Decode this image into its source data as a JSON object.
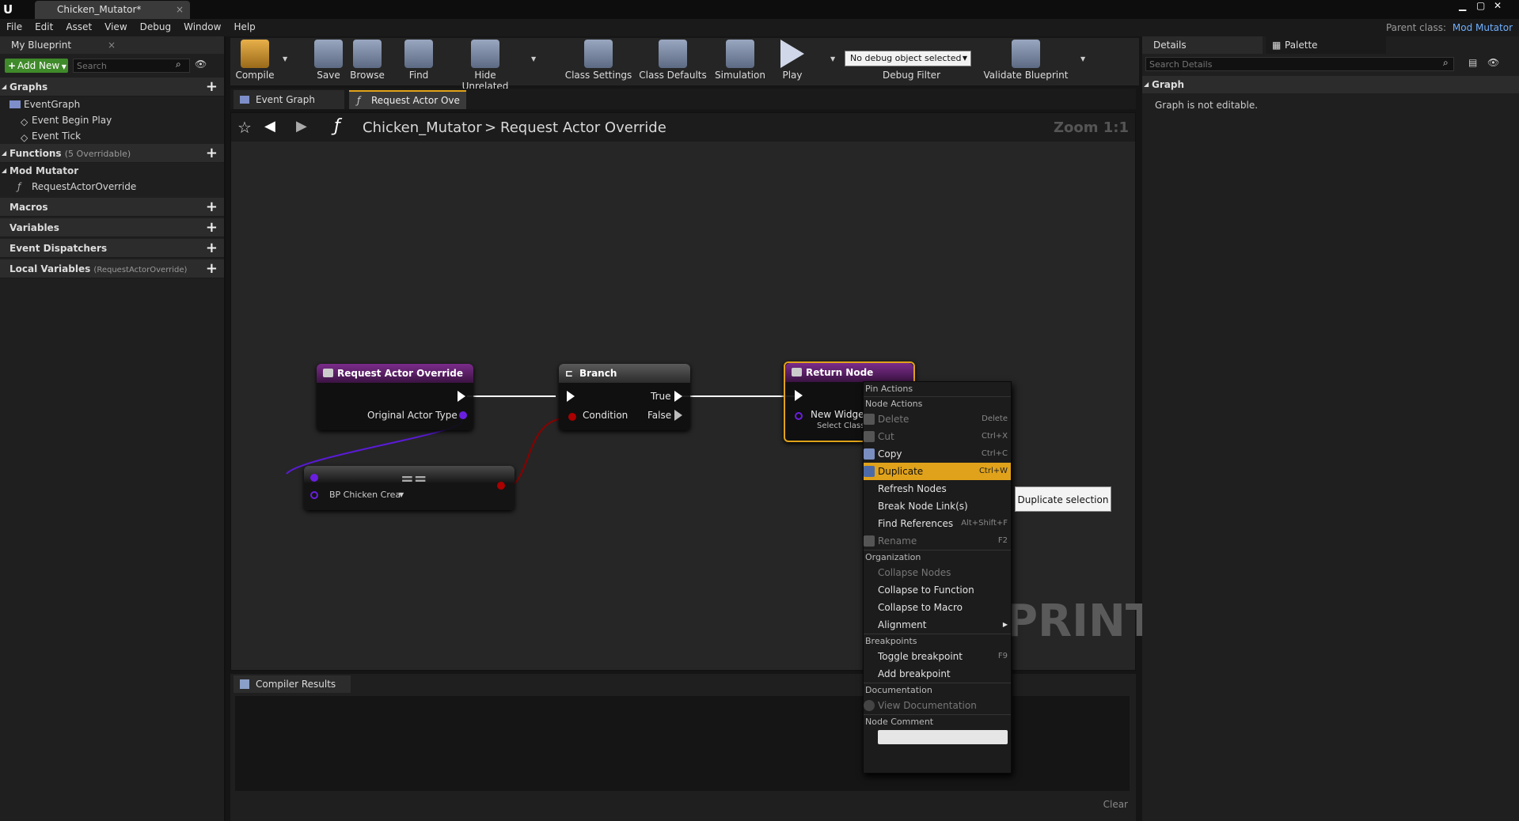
{
  "title_tab": "Chicken_Mutator*",
  "parent_class_label": "Parent class:",
  "parent_class_value": "Mod Mutator",
  "menu": [
    "File",
    "Edit",
    "Asset",
    "View",
    "Debug",
    "Window",
    "Help"
  ],
  "left": {
    "tab": "My Blueprint",
    "add_new": "Add New",
    "search_placeholder": "Search",
    "graphs": "Graphs",
    "graph_items": [
      "EventGraph",
      "Event Begin Play",
      "Event Tick"
    ],
    "functions": "Functions",
    "functions_note": "(5 Overridable)",
    "mod_mutator": "Mod Mutator",
    "function_item": "RequestActorOverride",
    "macros": "Macros",
    "variables": "Variables",
    "dispatchers": "Event Dispatchers",
    "locals": "Local Variables",
    "locals_note": "(RequestActorOverride)"
  },
  "toolbar": {
    "compile": "Compile",
    "save": "Save",
    "browse": "Browse",
    "find": "Find",
    "hide_unrelated": "Hide Unrelated",
    "class_settings": "Class Settings",
    "class_defaults": "Class Defaults",
    "simulation": "Simulation",
    "play": "Play",
    "debug_object": "No debug object selected",
    "debug_filter": "Debug Filter",
    "validate": "Validate Blueprint"
  },
  "doc_tabs": [
    "Event Graph",
    "Request Actor Ove"
  ],
  "breadcrumb": {
    "root": "Chicken_Mutator",
    "sep": ">",
    "current": "Request Actor Override"
  },
  "zoom": "Zoom 1:1",
  "watermark": "PRINT",
  "nodes": {
    "entry_title": "Request Actor Override",
    "entry_pin": "Original Actor Type",
    "branch_title": "Branch",
    "branch_true": "True",
    "branch_condition": "Condition",
    "branch_false": "False",
    "return_title": "Return Node",
    "return_pin": "New Widget",
    "return_sub": "Select Class",
    "equal_pin": "BP Chicken Crea",
    "equal_symbol": "=="
  },
  "context_menu": {
    "pin_actions": "Pin Actions",
    "node_actions": "Node Actions",
    "delete": "Delete",
    "delete_sc": "Delete",
    "cut": "Cut",
    "cut_sc": "Ctrl+X",
    "copy": "Copy",
    "copy_sc": "Ctrl+C",
    "duplicate": "Duplicate",
    "duplicate_sc": "Ctrl+W",
    "refresh": "Refresh Nodes",
    "break": "Break Node Link(s)",
    "find_refs": "Find References",
    "find_refs_sc": "Alt+Shift+F",
    "rename": "Rename",
    "rename_sc": "F2",
    "organization": "Organization",
    "collapse_nodes": "Collapse Nodes",
    "collapse_fn": "Collapse to Function",
    "collapse_macro": "Collapse to Macro",
    "alignment": "Alignment",
    "breakpoints": "Breakpoints",
    "toggle_bp": "Toggle breakpoint",
    "toggle_bp_sc": "F9",
    "add_bp": "Add breakpoint",
    "documentation": "Documentation",
    "view_doc": "View Documentation",
    "node_comment": "Node Comment"
  },
  "tooltip": "Duplicate selection",
  "compiler": {
    "tab": "Compiler Results",
    "clear": "Clear"
  },
  "right": {
    "details_tab": "Details",
    "palette_tab": "Palette",
    "search_placeholder": "Search Details",
    "graph_section": "Graph",
    "graph_note": "Graph is not editable."
  }
}
